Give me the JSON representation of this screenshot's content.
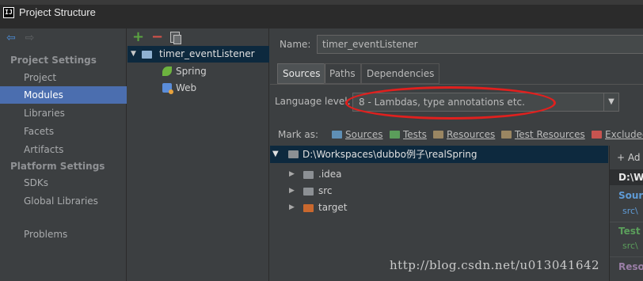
{
  "window": {
    "title": "Project Structure"
  },
  "nav": {
    "back_icon": "arrow-left-icon",
    "forward_icon": "arrow-right-icon",
    "sections": [
      {
        "title": "Project Settings",
        "items": [
          "Project",
          "Modules",
          "Libraries",
          "Facets",
          "Artifacts"
        ]
      },
      {
        "title": "Platform Settings",
        "items": [
          "SDKs",
          "Global Libraries"
        ]
      }
    ],
    "extra_items": [
      "Problems"
    ],
    "selected": "Modules"
  },
  "modules": {
    "toolbar": {
      "add": "+",
      "remove": "−"
    },
    "root": "timer_eventListener",
    "facets": [
      "Spring",
      "Web"
    ]
  },
  "module_settings": {
    "name_label": "Name:",
    "name_value": "timer_eventListener",
    "tabs": [
      "Sources",
      "Paths",
      "Dependencies"
    ],
    "active_tab": "Sources",
    "language_level_label": "Language level:",
    "language_level_value": "8 - Lambdas, type annotations etc.",
    "mark_as_label": "Mark as:",
    "mark_as": [
      {
        "label": "Sources",
        "color": "#5f8fb5"
      },
      {
        "label": "Tests",
        "color": "#5b9e5b"
      },
      {
        "label": "Resources",
        "color": "#9a8662"
      },
      {
        "label": "Test Resources",
        "color": "#9a8662"
      },
      {
        "label": "Excluded",
        "color": "#c75450"
      }
    ],
    "content_root": "D:\\Workspaces\\dubbo例子\\realSpring",
    "folders": [
      {
        "name": ".idea",
        "color": "#8c9094"
      },
      {
        "name": "src",
        "color": "#8c9094"
      },
      {
        "name": "target",
        "color": "#c9682e"
      }
    ],
    "side": {
      "add_label": "Ad",
      "path_header": "D:\\W",
      "groups": [
        {
          "title": "Sour",
          "sub": "src\\",
          "color": "#5f9bd6"
        },
        {
          "title": "Test",
          "sub": "src\\",
          "color": "#5b9e5b"
        },
        {
          "title": "Reso",
          "sub": "",
          "color": "#9a7ea6"
        }
      ]
    }
  },
  "watermark": "http://blog.csdn.net/u013041642",
  "annotation": {
    "color": "#e0201e"
  }
}
